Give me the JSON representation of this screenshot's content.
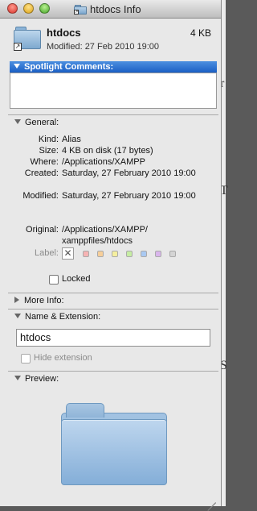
{
  "window": {
    "title": "htdocs Info"
  },
  "header": {
    "name": "htdocs",
    "size": "4 KB",
    "modified": "Modified: 27 Feb 2010 19:00"
  },
  "spotlight": {
    "label": "Spotlight Comments:",
    "value": ""
  },
  "general": {
    "label": "General:",
    "rows": [
      {
        "key": "Kind:",
        "value": "Alias"
      },
      {
        "key": "Size:",
        "value": "4 KB on disk (17 bytes)"
      },
      {
        "key": "Where:",
        "value": "/Applications/XAMPP"
      },
      {
        "key": "Created:",
        "value": "Saturday, 27 February 2010 19:00"
      },
      {
        "key": "Modified:",
        "value": "Saturday, 27 February 2010 19:00"
      },
      {
        "key": "Original:",
        "value": "/Applications/XAMPP/ xamppfiles/htdocs"
      }
    ],
    "label_key": "Label:",
    "label_none_symbol": "✕",
    "label_colors": [
      "#f6b3b3",
      "#f7cf9a",
      "#f5ef9f",
      "#c6eda3",
      "#a9c9f2",
      "#d9b5ec",
      "#d4d4d4"
    ],
    "locked_label": "Locked",
    "locked_checked": false
  },
  "more_info": {
    "label": "More Info:"
  },
  "name_extension": {
    "label": "Name & Extension:",
    "value": "htdocs",
    "hide_extension_label": "Hide extension",
    "hide_extension_checked": false
  },
  "preview": {
    "label": "Preview:"
  },
  "background_glyphs": [
    "r",
    "T",
    "S"
  ]
}
